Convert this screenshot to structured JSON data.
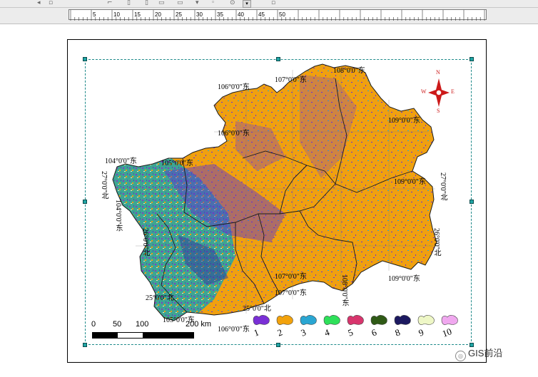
{
  "ruler": {
    "ticks": [
      "5",
      "10",
      "15",
      "20",
      "25",
      "30",
      "35",
      "40",
      "45",
      "50"
    ]
  },
  "grid_labels": {
    "top": [
      "106°0'0\"东",
      "107°0'0\"东",
      "108°0'0\"东",
      "106°0'0\"东",
      "104°0'0\"东",
      "105°0'0\"东",
      "109°0'0\"东"
    ],
    "left_vertical": [
      "27°0'0\"北",
      "104°0'0\"东",
      "26°0'0\"北"
    ],
    "right_vertical": [
      "27°0'0\"北",
      "26°0'0\"北"
    ],
    "bottom": [
      "107°0'0\"东",
      "107°0'0\"东",
      "109°0'0\"东",
      "25°0'0\"北",
      "25°0'0\"北",
      "105°0'0\"东",
      "106°0'0\"东"
    ],
    "vertical_mid": [
      "108°0'0\"东",
      "104°0'0\"东"
    ]
  },
  "north_arrow": {
    "n": "N",
    "s": "S",
    "e": "E",
    "w": "W"
  },
  "scale_bar": {
    "labels": [
      "0",
      "50",
      "100",
      "200 km"
    ]
  },
  "legend": {
    "items": [
      {
        "label": "1",
        "color": "#7a2fd6"
      },
      {
        "label": "2",
        "color": "#f2a20c"
      },
      {
        "label": "3",
        "color": "#2aa6d2"
      },
      {
        "label": "4",
        "color": "#2ee05a"
      },
      {
        "label": "5",
        "color": "#d8356d"
      },
      {
        "label": "6",
        "color": "#2f5a16"
      },
      {
        "label": "8",
        "color": "#1c1960"
      },
      {
        "label": "9",
        "color": "#eef7c6"
      },
      {
        "label": "10",
        "color": "#f0a8ef"
      }
    ]
  },
  "colors": {
    "province_fill": "#f0a00f",
    "frame_dash": "#1e8a8a",
    "handle": "#1fa5a5"
  },
  "watermark": {
    "text": "GIS前沿"
  }
}
